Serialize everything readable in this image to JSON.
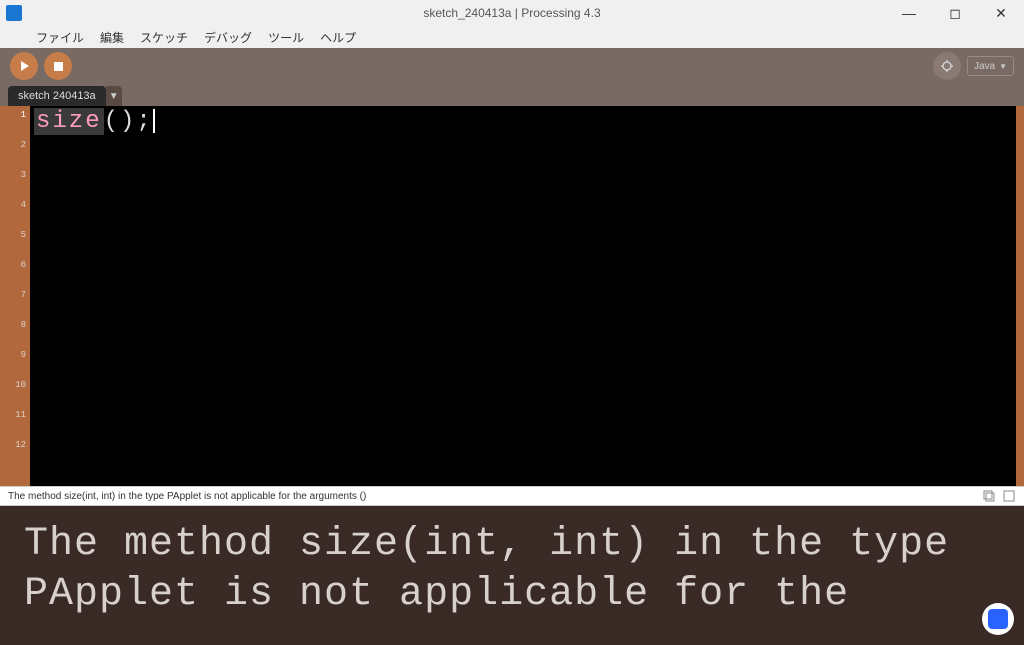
{
  "window": {
    "title": "sketch_240413a | Processing 4.3"
  },
  "menubar": {
    "file": "ファイル",
    "edit": "編集",
    "sketch": "スケッチ",
    "debug": "デバッグ",
    "tools": "ツール",
    "help": "ヘルプ"
  },
  "toolbar": {
    "mode": "Java"
  },
  "tabs": {
    "name": "sketch 240413a"
  },
  "code": {
    "func": "size",
    "rest": "();"
  },
  "gutter": {
    "l1": "1",
    "l2": "2",
    "l3": "3",
    "l4": "4",
    "l5": "5",
    "l6": "6",
    "l7": "7",
    "l8": "8",
    "l9": "9",
    "l10": "10",
    "l11": "11",
    "l12": "12"
  },
  "status": {
    "message": "The method size(int, int) in the type PApplet is not applicable for the arguments ()"
  },
  "console": {
    "text": "The method size(int, int) in the type PApplet is not applicable for the"
  }
}
